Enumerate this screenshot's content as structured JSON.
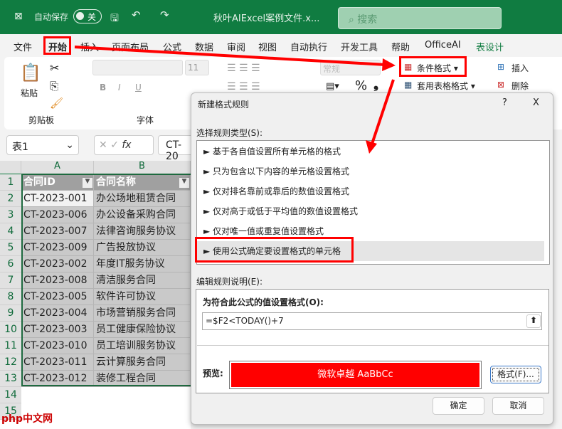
{
  "titlebar": {
    "autosave_label": "自动保存",
    "autosave_state": "关",
    "filename": "秋叶AIExcel案例文件.x...",
    "search_placeholder": "搜索",
    "brand_color": "#107c41"
  },
  "menu": [
    "文件",
    "开始",
    "插入",
    "页面布局",
    "公式",
    "数据",
    "审阅",
    "视图",
    "自动执行",
    "开发工具",
    "帮助",
    "OfficeAI",
    "表设计"
  ],
  "ribbon": {
    "paste": "粘贴",
    "clipboard": "剪贴板",
    "font_size": "11",
    "font_group": "字体",
    "number_format": "常规",
    "percent": "%",
    "comma": "❟",
    "conditional_format": "条件格式",
    "table_format": "套用表格格式",
    "insert": "插入",
    "delete": "删除",
    "bold": "B",
    "italic": "I",
    "underline": "U"
  },
  "formula_bar": {
    "name_box": "表1",
    "fx": "fx",
    "value": "CT-20"
  },
  "sheet": {
    "columns": [
      "A",
      "B"
    ],
    "headers": [
      "合同ID",
      "合同名称"
    ],
    "rows": [
      [
        "CT-2023-001",
        "办公场地租赁合同"
      ],
      [
        "CT-2023-006",
        "办公设备采购合同"
      ],
      [
        "CT-2023-007",
        "法律咨询服务协议"
      ],
      [
        "CT-2023-009",
        "广告投放协议"
      ],
      [
        "CT-2023-002",
        "年度IT服务协议"
      ],
      [
        "CT-2023-008",
        "清洁服务合同"
      ],
      [
        "CT-2023-005",
        "软件许可协议"
      ],
      [
        "CT-2023-004",
        "市场营销服务合同"
      ],
      [
        "CT-2023-003",
        "员工健康保险协议"
      ],
      [
        "CT-2023-010",
        "员工培训服务协议"
      ],
      [
        "CT-2023-011",
        "云计算服务合同"
      ],
      [
        "CT-2023-012",
        "装修工程合同"
      ]
    ],
    "row_numbers": [
      "1",
      "2",
      "3",
      "4",
      "5",
      "6",
      "7",
      "8",
      "9",
      "10",
      "11",
      "12",
      "13",
      "14",
      "15"
    ]
  },
  "dialog": {
    "title": "新建格式规则",
    "help": "?",
    "close": "X",
    "rule_type_label": "选择规则类型(S):",
    "rule_types": [
      "► 基于各自值设置所有单元格的格式",
      "► 只为包含以下内容的单元格设置格式",
      "► 仅对排名靠前或靠后的数值设置格式",
      "► 仅对高于或低于平均值的数值设置格式",
      "► 仅对唯一值或重复值设置格式",
      "► 使用公式确定要设置格式的单元格"
    ],
    "edit_label": "编辑规则说明(E):",
    "formula_label": "为符合此公式的值设置格式(O):",
    "formula": "=$F2<TODAY()+7",
    "preview_label": "预览:",
    "preview_text": "微软卓越  AaBbCc",
    "preview_color": "#ff0000",
    "format_button": "格式(F)...",
    "ok": "确定",
    "cancel": "取消"
  },
  "watermark": "php中文网"
}
